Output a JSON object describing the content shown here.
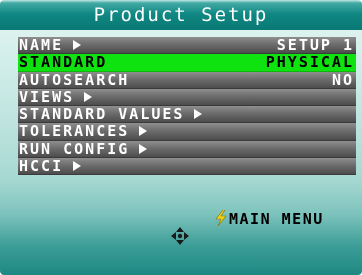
{
  "title": "Product Setup",
  "menu": [
    {
      "label": "NAME",
      "has_submenu": true,
      "value": "SETUP 1",
      "selected": false
    },
    {
      "label": "STANDARD",
      "has_submenu": false,
      "value": "PHYSICAL",
      "selected": true
    },
    {
      "label": "AUTOSEARCH",
      "has_submenu": false,
      "value": "NO",
      "selected": false
    },
    {
      "label": "VIEWS",
      "has_submenu": true,
      "value": "",
      "selected": false
    },
    {
      "label": "STANDARD VALUES",
      "has_submenu": true,
      "value": "",
      "selected": false
    },
    {
      "label": "TOLERANCES",
      "has_submenu": true,
      "value": "",
      "selected": false
    },
    {
      "label": "RUN CONFIG",
      "has_submenu": true,
      "value": "",
      "selected": false
    },
    {
      "label": "HCCI",
      "has_submenu": true,
      "value": "",
      "selected": false
    }
  ],
  "main_menu_label": "MAIN MENU",
  "icons": {
    "submenu": "arrow-right-icon",
    "main_menu": "lightning-bolt-icon",
    "navigation": "directional-pad-icon"
  },
  "colors": {
    "title_bar": "#0a7a75",
    "selected_row": "#0fe30f",
    "row_gray": "#6d6d6d",
    "bolt": "#f2d21b"
  }
}
